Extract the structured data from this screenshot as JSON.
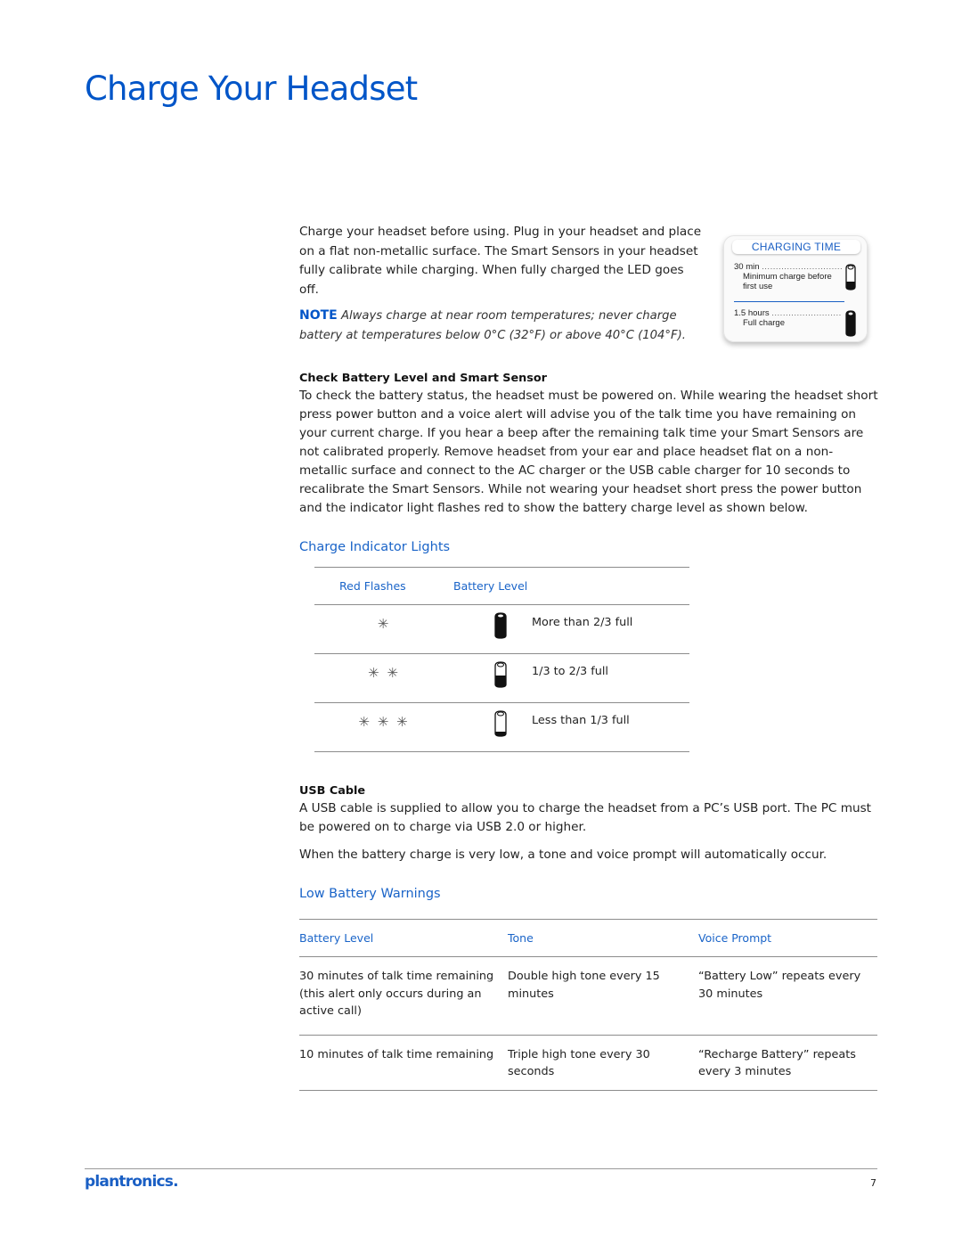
{
  "page": {
    "title": "Charge Your Headset",
    "intro": "Charge your headset before using. Plug in your headset and place on a flat non-metallic surface. The Smart Sensors in your headset fully calibrate while charging. When fully charged the LED goes off.",
    "note": {
      "label": "NOTE",
      "text": "Always charge at near room temperatures; never charge battery at temperatures below 0°C (32°F) or above 40°C (104°F)."
    },
    "accent_color": "#0055c8"
  },
  "charging_time": {
    "title": "CHARGING TIME",
    "rows": [
      {
        "time": "30 min",
        "desc": "Minimum charge before first use",
        "icon": "battery-partial-icon"
      },
      {
        "time": "1.5 hours",
        "desc": "Full charge",
        "icon": "battery-full-icon"
      }
    ]
  },
  "check_battery": {
    "heading": "Check Battery Level and Smart Sensor",
    "body": "To check the battery status, the headset must be powered on. While wearing the headset short press power button and a voice alert will advise you of the talk time you have remaining on your current charge. If you hear a beep after the remaining talk time your Smart Sensors are not calibrated properly. Remove headset from your ear and place headset flat on a non-metallic surface and connect to the AC charger or the USB cable charger for 10 seconds to recalibrate the Smart Sensors. While not wearing your headset short press the power button and the indicator light flashes red to show the battery charge level as shown below."
  },
  "charge_indicator": {
    "heading": "Charge Indicator Lights",
    "columns": [
      "Red Flashes",
      "Battery Level"
    ],
    "rows": [
      {
        "flashes": "✳",
        "flash_count": 1,
        "icon": "battery-full-icon",
        "level": "More than 2/3 full",
        "fill": 1.0
      },
      {
        "flashes": "✳ ✳",
        "flash_count": 2,
        "icon": "battery-half-icon",
        "level": "1/3 to 2/3 full",
        "fill": 0.5
      },
      {
        "flashes": "✳ ✳ ✳",
        "flash_count": 3,
        "icon": "battery-low-icon",
        "level": "Less than 1/3 full",
        "fill": 0.15
      }
    ]
  },
  "usb_cable": {
    "heading": "USB Cable",
    "body": "A USB cable is supplied to allow you to charge the headset from a PC’s USB port. The PC must be powered on to charge via USB 2.0 or higher.",
    "low_note": "When the battery charge is very low, a tone and voice prompt will automatically occur."
  },
  "low_battery": {
    "heading": "Low Battery Warnings",
    "columns": [
      "Battery Level",
      "Tone",
      "Voice Prompt"
    ],
    "rows": [
      {
        "level": "30 minutes of talk time remaining (this alert only occurs during an active call)",
        "tone": "Double high tone every 15 minutes",
        "prompt": "“Battery Low” repeats every 30 minutes"
      },
      {
        "level": "10 minutes of talk time remaining",
        "tone": "Triple high tone every 30 seconds",
        "prompt": "“Recharge Battery” repeats every 3 minutes"
      }
    ]
  },
  "footer": {
    "logo": "plantronics.",
    "page_number": "7"
  }
}
